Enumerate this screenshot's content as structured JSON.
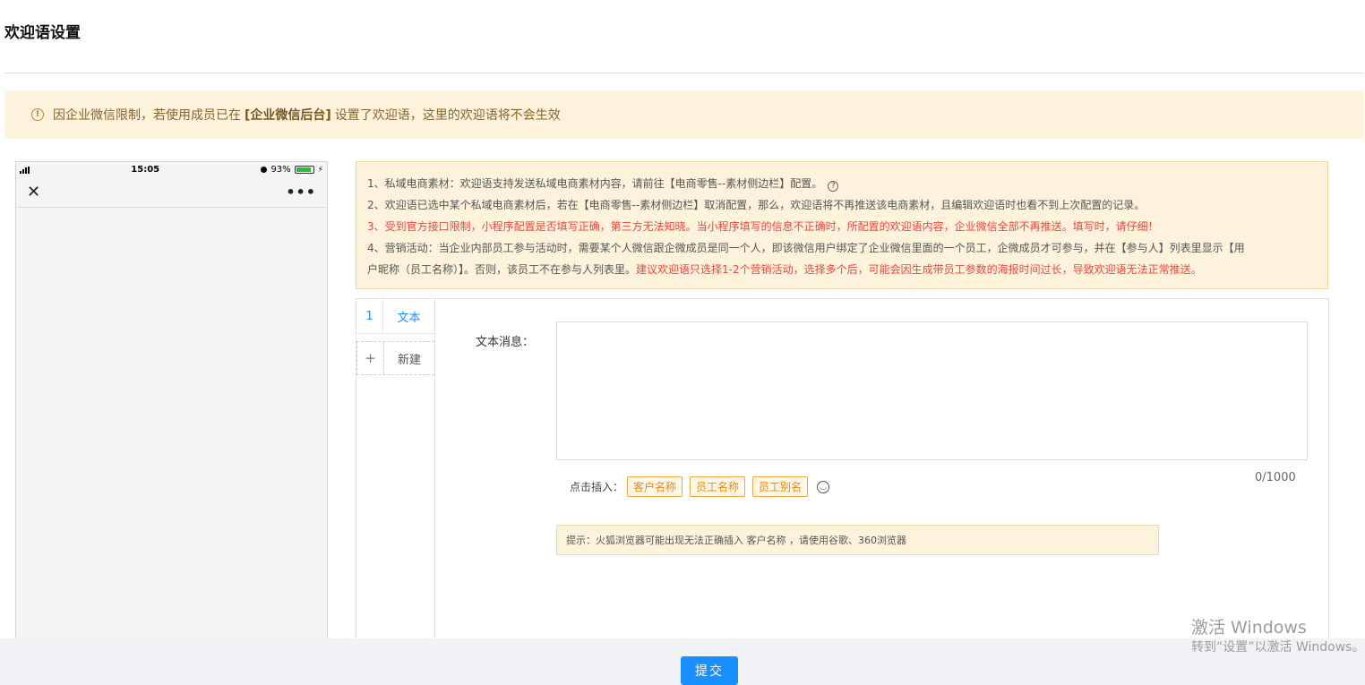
{
  "header": {
    "title": "欢迎语设置"
  },
  "warning": {
    "prefix": "因企业微信限制，若使用成员已在",
    "highlight": "[企业微信后台]",
    "suffix": "设置了欢迎语，这里的欢迎语将不会生效"
  },
  "phone": {
    "time": "15:05",
    "battery": "93%",
    "battery_level": 0.93
  },
  "notes": {
    "line1": "1、私域电商素材：欢迎语支持发送私域电商素材内容，请前往【电商零售--素材侧边栏】配置。",
    "line2": "2、欢迎语已选中某个私域电商素材后，若在【电商零售--素材侧边栏】取消配置，那么，欢迎语将不再推送该电商素材，且编辑欢迎语时也看不到上次配置的记录。",
    "line3": "3、受到官方接口限制，小程序配置是否填写正确，第三方无法知晓。当小程序填写的信息不正确时，所配置的欢迎语内容，企业微信全部不再推送。填写时，请仔细！",
    "line4a": "4、营销活动：当企业内部员工参与活动时，需要某个人微信跟企微成员是同一个人，即该微信用户绑定了企业微信里面的一个员工，企微成员才可参与，并在【参与人】列表里显示【用",
    "line4b": "户昵称（员工名称）】。否则，该员工不在参与人列表里。",
    "line4c": "建议欢迎语只选择1-2个营销活动，选择多个后，可能会因生成带员工参数的海报时间过长，导致欢迎语无法正常推送。"
  },
  "tabs": [
    {
      "num": "1",
      "label": "文本"
    }
  ],
  "new_tab": {
    "icon": "+",
    "label": "新建"
  },
  "editor": {
    "label": "文本消息：",
    "value": "",
    "counter": "0/1000",
    "insert_label": "点击插入：",
    "tags": [
      "客户名称",
      "员工名称",
      "员工别名"
    ],
    "hint": "提示：火狐浏览器可能出现无法正确插入 客户名称 ，请使用谷歌、360浏览器"
  },
  "footer": {
    "submit": "提交"
  },
  "watermark": {
    "line1": "激活 Windows",
    "line2": "转到“设置”以激活 Windows。"
  },
  "colors": {
    "primary": "#1890ff",
    "warning_bg": "#fdf3dd",
    "danger": "#f0443a",
    "tag": "#e8870e"
  }
}
